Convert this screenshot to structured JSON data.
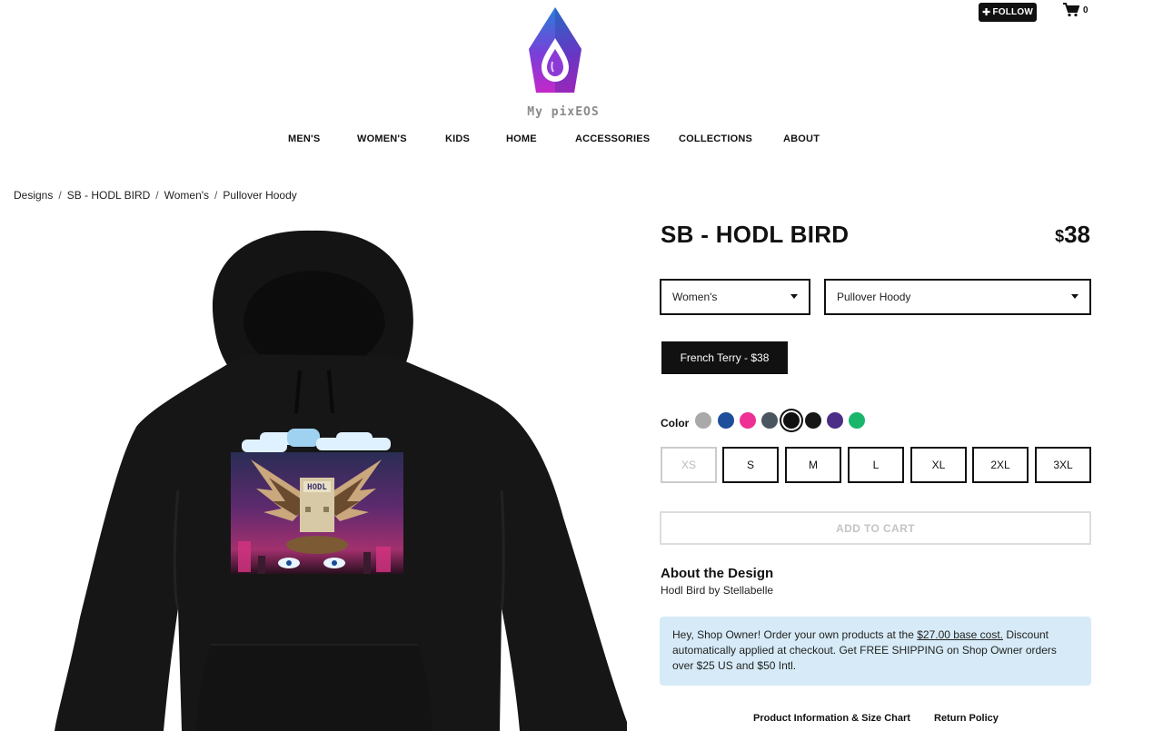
{
  "header": {
    "follow_label": "FOLLOW",
    "cart_count": "0",
    "logo_text": "My pixEOS"
  },
  "nav": {
    "items": [
      "MEN'S",
      "WOMEN'S",
      "KIDS",
      "HOME",
      "ACCESSORIES",
      "COLLECTIONS",
      "ABOUT"
    ]
  },
  "breadcrumb": {
    "items": [
      "Designs",
      "SB - HODL BIRD",
      "Women's",
      "Pullover Hoody"
    ]
  },
  "product": {
    "title": "SB - HODL BIRD",
    "currency": "$",
    "price": "38",
    "gender_select": "Women's",
    "type_select": "Pullover Hoody",
    "style_option": "French Terry - $38",
    "color_label": "Color",
    "colors": [
      "#a9a9a9",
      "#1f4f9a",
      "#ef2f93",
      "#4a5560",
      "#111111",
      "#161616",
      "#4b2e86",
      "#19b56a"
    ],
    "selected_color_index": 4,
    "sizes": [
      "XS",
      "S",
      "M",
      "L",
      "XL",
      "2XL",
      "3XL"
    ],
    "add_to_cart": "ADD TO CART",
    "image_text": "HODL"
  },
  "about": {
    "title": "About the Design",
    "subtitle": "Hodl Bird by Stellabelle"
  },
  "owner_note": {
    "text_before": "Hey, Shop Owner! Order your own products at the ",
    "link": "$27.00 base cost.",
    "text_after": " Discount automatically applied at checkout. Get FREE SHIPPING on Shop Owner orders over $25 US and $50 Intl."
  },
  "footer": {
    "product_info": "Product Information & Size Chart",
    "return_policy": "Return Policy"
  }
}
